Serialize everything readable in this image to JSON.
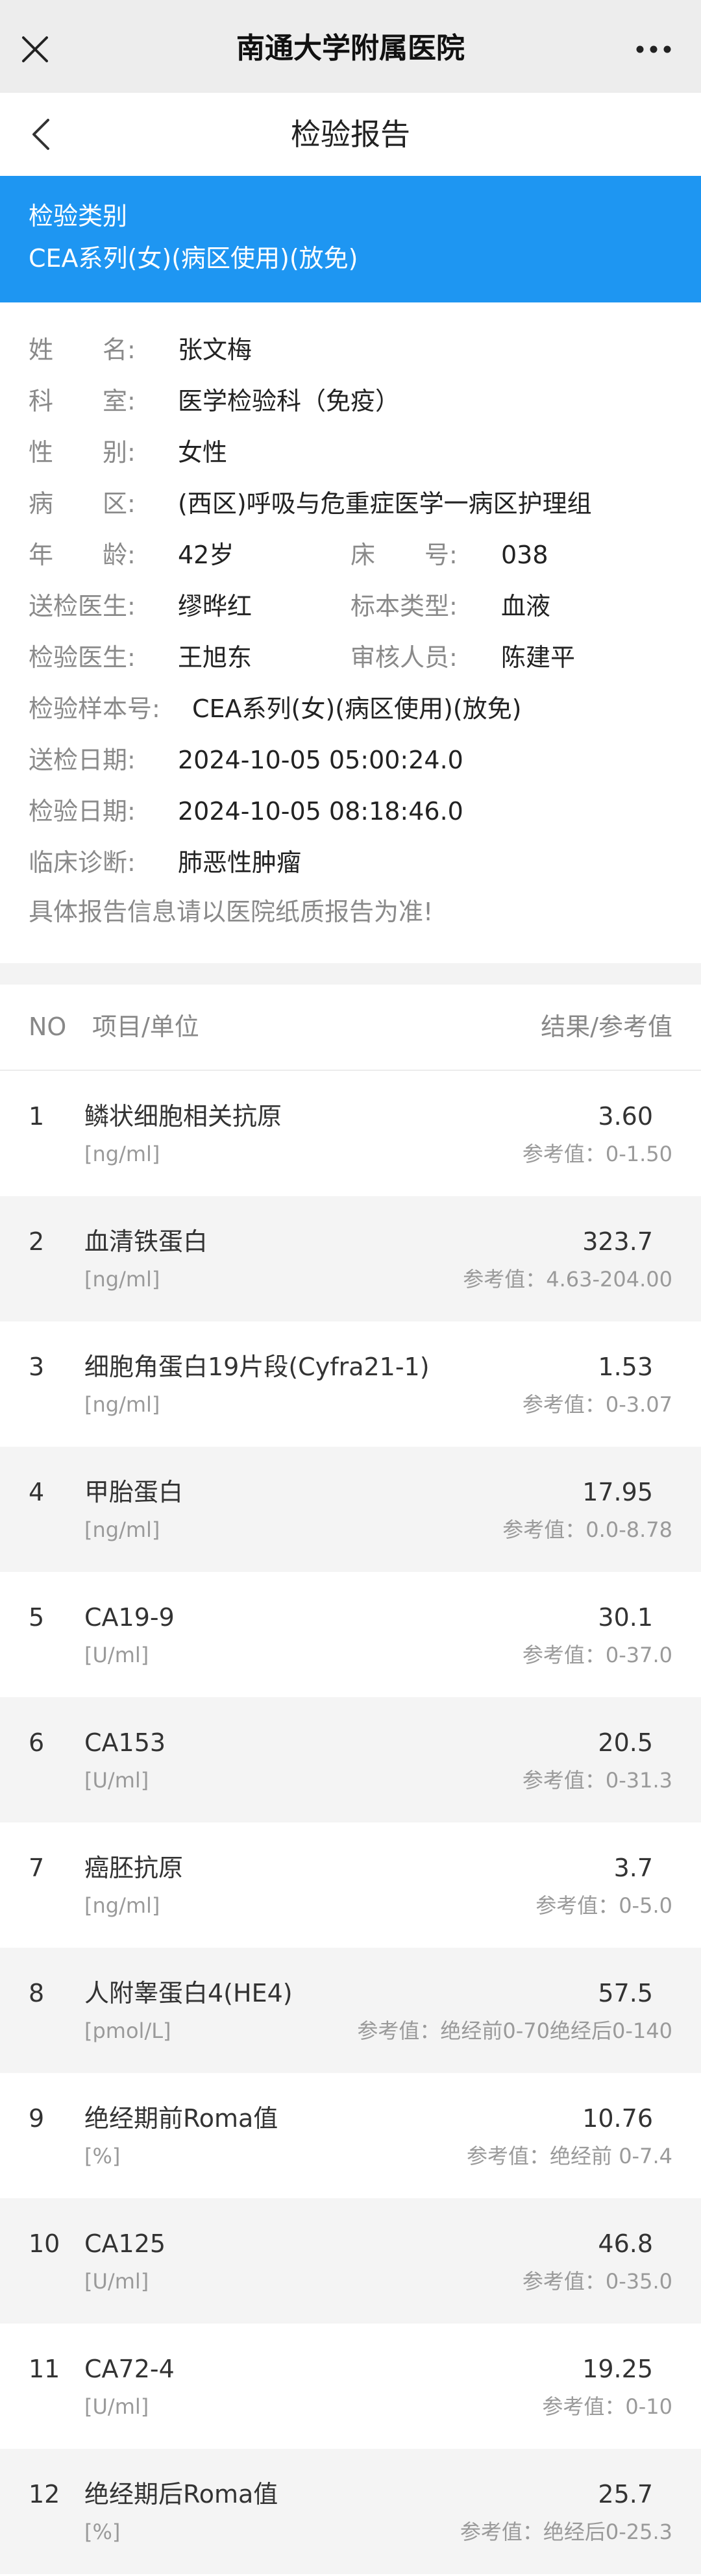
{
  "app": {
    "title": "南通大学附属医院"
  },
  "nav": {
    "title": "检验报告"
  },
  "category": {
    "label": "检验类别",
    "value": "CEA系列(女)(病区使用)(放免)"
  },
  "patient": {
    "name_label": "姓　　名:",
    "name": "张文梅",
    "dept_label": "科　　室:",
    "dept": "医学检验科（免疫）",
    "gender_label": "性　　别:",
    "gender": "女性",
    "ward_label": "病　　区:",
    "ward": "(西区)呼吸与危重症医学一病区护理组",
    "age_label": "年　　龄:",
    "age": "42岁",
    "bed_label": "床　　号:",
    "bed": "038",
    "sender_label": "送检医生:",
    "sender": "缪晔红",
    "specimen_label": "标本类型:",
    "specimen": "血液",
    "tester_label": "检验医生:",
    "tester": "王旭东",
    "reviewer_label": "审核人员:",
    "reviewer": "陈建平",
    "sample_no_label": "检验样本号:",
    "sample_no": "CEA系列(女)(病区使用)(放免)",
    "send_date_label": "送检日期:",
    "send_date": "2024-10-05 05:00:24.0",
    "test_date_label": "检验日期:",
    "test_date": "2024-10-05 08:18:46.0",
    "diagnosis_label": "临床诊断:",
    "diagnosis": "肺恶性肿瘤",
    "note": "具体报告信息请以医院纸质报告为准!"
  },
  "table": {
    "header_no": "NO",
    "header_item": "项目/单位",
    "header_result": "结果/参考值",
    "rows": [
      {
        "no": "1",
        "name": "鳞状细胞相关抗原",
        "unit": "[ng/ml]",
        "value": "3.60",
        "ref": "参考值：0-1.50"
      },
      {
        "no": "2",
        "name": "血清铁蛋白",
        "unit": "[ng/ml]",
        "value": "323.7",
        "ref": "参考值：4.63-204.00"
      },
      {
        "no": "3",
        "name": "细胞角蛋白19片段(Cyfra21-1)",
        "unit": "[ng/ml]",
        "value": "1.53",
        "ref": "参考值：0-3.07"
      },
      {
        "no": "4",
        "name": "甲胎蛋白",
        "unit": "[ng/ml]",
        "value": "17.95",
        "ref": "参考值：0.0-8.78"
      },
      {
        "no": "5",
        "name": "CA19-9",
        "unit": "[U/ml]",
        "value": "30.1",
        "ref": "参考值：0-37.0"
      },
      {
        "no": "6",
        "name": "CA153",
        "unit": "[U/ml]",
        "value": "20.5",
        "ref": "参考值：0-31.3"
      },
      {
        "no": "7",
        "name": "癌胚抗原",
        "unit": "[ng/ml]",
        "value": "3.7",
        "ref": "参考值：0-5.0"
      },
      {
        "no": "8",
        "name": "人附睾蛋白4(HE4)",
        "unit": "[pmol/L]",
        "value": "57.5",
        "ref": "参考值：绝经前0-70绝经后0-140"
      },
      {
        "no": "9",
        "name": "绝经期前Roma值",
        "unit": "[%]",
        "value": "10.76",
        "ref": "参考值：绝经前 0-7.4"
      },
      {
        "no": "10",
        "name": "CA125",
        "unit": "[U/ml]",
        "value": "46.8",
        "ref": "参考值：0-35.0"
      },
      {
        "no": "11",
        "name": "CA72-4",
        "unit": "[U/ml]",
        "value": "19.25",
        "ref": "参考值：0-10"
      },
      {
        "no": "12",
        "name": "绝经期后Roma值",
        "unit": "[%]",
        "value": "25.7",
        "ref": "参考值：绝经后0-25.3"
      }
    ]
  }
}
